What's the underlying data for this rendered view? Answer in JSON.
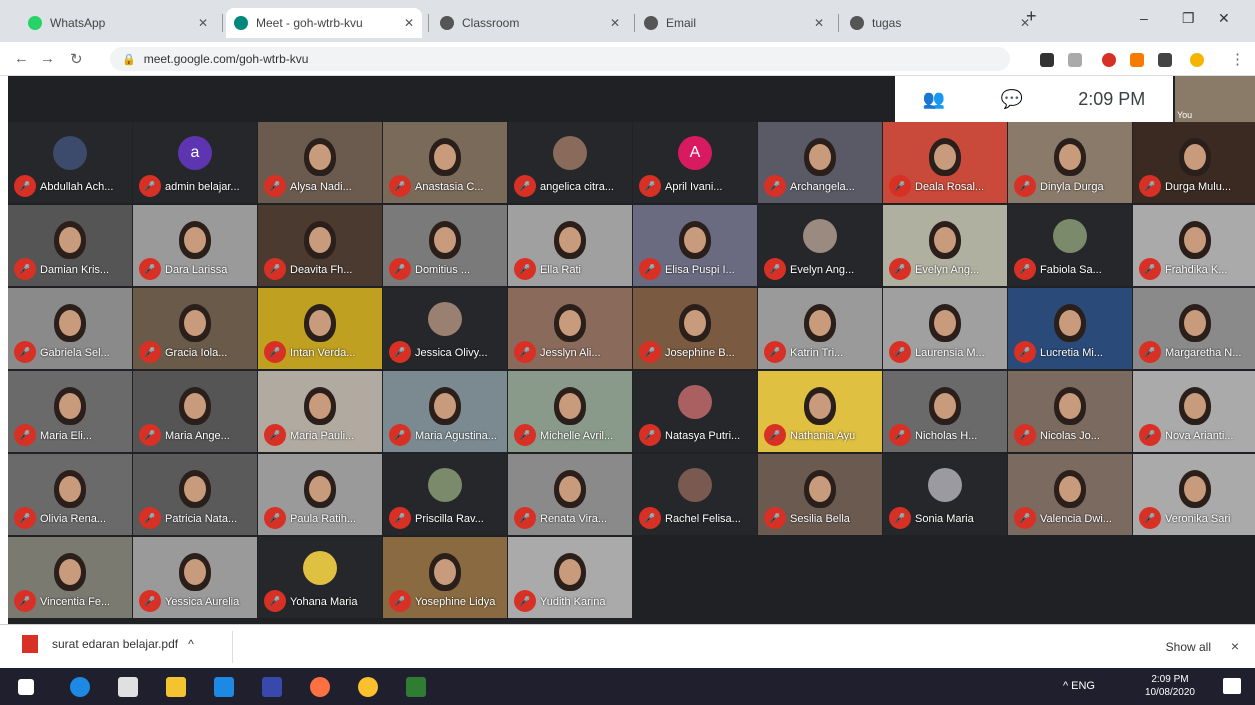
{
  "browser": {
    "tabs": [
      {
        "title": "WhatsApp",
        "icon_color": "#25d366",
        "active": false
      },
      {
        "title": "Meet - goh-wtrb-kvu",
        "icon_color": "#00897b",
        "active": true
      },
      {
        "title": "Classroom",
        "icon_color": "#555555",
        "active": false
      },
      {
        "title": "Email",
        "icon_color": "#555555",
        "active": false
      },
      {
        "title": "tugas",
        "icon_color": "#555555",
        "active": false
      }
    ],
    "new_tab": "+",
    "window_min": "–",
    "window_max": "❐",
    "url": "meet.google.com/goh-wtrb-kvu",
    "nav": {
      "back": "←",
      "forward": "→",
      "reload": "↻"
    }
  },
  "meet": {
    "clock": "2:09 PM",
    "captions_icon": "people-icon",
    "chat_icon": "chat-icon",
    "self_label": "You",
    "accent": "#d93025",
    "participants": [
      {
        "name": "Abdullah Ach...",
        "kind": "avatar",
        "initial": "",
        "color": "#3c4a6b"
      },
      {
        "name": "admin belajar...",
        "kind": "avatar",
        "initial": "a",
        "color": "#5e35b1"
      },
      {
        "name": "Alysa Nadi...",
        "kind": "video",
        "color": "#6b5a4e"
      },
      {
        "name": "Anastasia C...",
        "kind": "video",
        "color": "#7a6a5a"
      },
      {
        "name": "angelica citra...",
        "kind": "avatar",
        "initial": "",
        "color": "#8a6a5a"
      },
      {
        "name": "April Ivani...",
        "kind": "avatar",
        "initial": "A",
        "color": "#d81b60"
      },
      {
        "name": "Archangela...",
        "kind": "video",
        "color": "#5a5a66"
      },
      {
        "name": "Deala Rosal...",
        "kind": "video",
        "color": "#c94a3a"
      },
      {
        "name": "Dinyla Durga",
        "kind": "video",
        "color": "#8a7a6a"
      },
      {
        "name": "Durga Mulu...",
        "kind": "video",
        "color": "#3a2a22"
      },
      {
        "name": "Damian Kris...",
        "kind": "video",
        "color": "#555555"
      },
      {
        "name": "Dara Larissa",
        "kind": "video",
        "color": "#9a9a9a"
      },
      {
        "name": "Deavita Fh...",
        "kind": "video",
        "color": "#4a3a30"
      },
      {
        "name": "Domitius ...",
        "kind": "video",
        "color": "#7a7a7a"
      },
      {
        "name": "Ella Rati",
        "kind": "video",
        "color": "#a0a0a0"
      },
      {
        "name": "Elisa Puspi I...",
        "kind": "video",
        "color": "#6a6a80"
      },
      {
        "name": "Evelyn Ang...",
        "kind": "avatar",
        "initial": "",
        "color": "#9a8a80"
      },
      {
        "name": "Evelyn Ang...",
        "kind": "video",
        "color": "#b0b0a0"
      },
      {
        "name": "Fabiola Sa...",
        "kind": "avatar",
        "initial": "",
        "color": "#7a8a6a"
      },
      {
        "name": "Frahdika K...",
        "kind": "video",
        "color": "#aaaaaa"
      },
      {
        "name": "Gabriela Sel...",
        "kind": "video",
        "color": "#8a8a8a"
      },
      {
        "name": "Gracia Iola...",
        "kind": "video",
        "color": "#6a5a4a"
      },
      {
        "name": "Intan Verda...",
        "kind": "video",
        "color": "#c0a020"
      },
      {
        "name": "Jessica Olivy...",
        "kind": "avatar",
        "initial": "",
        "color": "#9a8070"
      },
      {
        "name": "Jesslyn Ali...",
        "kind": "video",
        "color": "#8a6a5a"
      },
      {
        "name": "Josephine B...",
        "kind": "video",
        "color": "#7a5a40"
      },
      {
        "name": "Katrin Tri...",
        "kind": "video",
        "color": "#9a9a9a"
      },
      {
        "name": "Laurensia M...",
        "kind": "video",
        "color": "#a0a0a0"
      },
      {
        "name": "Lucretia Mi...",
        "kind": "video",
        "color": "#2a4a7a"
      },
      {
        "name": "Margaretha N...",
        "kind": "video",
        "color": "#8a8a8a"
      },
      {
        "name": "Maria Eli...",
        "kind": "video",
        "color": "#6a6a6a"
      },
      {
        "name": "Maria Ange...",
        "kind": "video",
        "color": "#555555"
      },
      {
        "name": "Maria Pauli...",
        "kind": "video",
        "color": "#b0aaa0"
      },
      {
        "name": "Maria Agustina...",
        "kind": "video",
        "color": "#7a8a90"
      },
      {
        "name": "Michelle Avril...",
        "kind": "video",
        "color": "#8a9a8a"
      },
      {
        "name": "Natasya Putri...",
        "kind": "avatar",
        "initial": "",
        "color": "#aa6060"
      },
      {
        "name": "Nathania Ayu",
        "kind": "video",
        "color": "#e0c040"
      },
      {
        "name": "Nicholas H...",
        "kind": "video",
        "color": "#6a6a6a"
      },
      {
        "name": "Nicolas Jo...",
        "kind": "video",
        "color": "#7a6a60"
      },
      {
        "name": "Nova Arianti...",
        "kind": "video",
        "color": "#aaaaaa"
      },
      {
        "name": "Olivia Rena...",
        "kind": "video",
        "color": "#6a6a6a"
      },
      {
        "name": "Patricia Nata...",
        "kind": "video",
        "color": "#5a5a5a"
      },
      {
        "name": "Paula Ratih...",
        "kind": "video",
        "color": "#9a9a9a"
      },
      {
        "name": "Priscilla Rav...",
        "kind": "avatar",
        "initial": "",
        "color": "#7a8a6a"
      },
      {
        "name": "Renata Vira...",
        "kind": "video",
        "color": "#8a8a8a"
      },
      {
        "name": "Rachel Felisa...",
        "kind": "avatar",
        "initial": "",
        "color": "#7a5a50"
      },
      {
        "name": "Sesilia Bella",
        "kind": "video",
        "color": "#6a5a50"
      },
      {
        "name": "Sonia Maria",
        "kind": "avatar",
        "initial": "",
        "color": "#9a9aa0"
      },
      {
        "name": "Valencia Dwi...",
        "kind": "video",
        "color": "#7a6a60"
      },
      {
        "name": "Veronika Sari",
        "kind": "video",
        "color": "#aaaaaa"
      },
      {
        "name": "Vincentia Fe...",
        "kind": "video",
        "color": "#7a7a70"
      },
      {
        "name": "Yessica Aurelia",
        "kind": "video",
        "color": "#9a9a9a"
      },
      {
        "name": "Yohana Maria",
        "kind": "avatar",
        "initial": "",
        "color": "#e0c040"
      },
      {
        "name": "Yosephine Lidya",
        "kind": "video",
        "color": "#8a6a40"
      },
      {
        "name": "Yudith Karina",
        "kind": "video",
        "color": "#aaaaaa"
      }
    ]
  },
  "download": {
    "file": "surat edaran belajar.pdf",
    "chevron": "^",
    "show_all": "Show all",
    "close": "×"
  },
  "taskbar": {
    "clock_time": "2:09 PM",
    "clock_date": "10/08/2020",
    "tray_text": "^ ENG"
  }
}
